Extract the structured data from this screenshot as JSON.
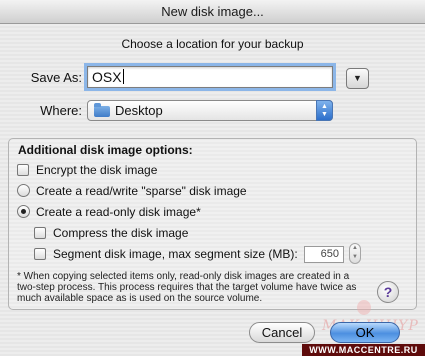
{
  "window": {
    "title": "New disk image..."
  },
  "prompt": "Choose a location for your backup",
  "save_as": {
    "label": "Save As:",
    "value": "OSX"
  },
  "where": {
    "label": "Where:",
    "selected": "Desktop",
    "icon": "folder-icon"
  },
  "options": {
    "title": "Additional disk image options:",
    "encrypt": {
      "label": "Encrypt the disk image",
      "checked": false
    },
    "sparse": {
      "label": "Create a read/write \"sparse\" disk image",
      "selected": false
    },
    "readonly": {
      "label": "Create a read-only disk image*",
      "selected": true
    },
    "compress": {
      "label": "Compress the disk image",
      "checked": false
    },
    "segment": {
      "label": "Segment disk image, max segment size (MB):",
      "checked": false,
      "size": "650"
    }
  },
  "note": "* When copying selected items only, read-only disk images are created in a two-step process. This process requires that the target volume have twice as much available space as is used on the source volume.",
  "help_label": "?",
  "buttons": {
    "cancel": "Cancel",
    "ok": "OK"
  },
  "watermark": {
    "logo_text": "MAK.IIIHYP",
    "site": "WWW.MACCENTRE.RU"
  },
  "colors": {
    "accent": "#4c8fe0",
    "focus_ring": "#8cb6e8",
    "watermark_bar": "#5e0b0b"
  }
}
